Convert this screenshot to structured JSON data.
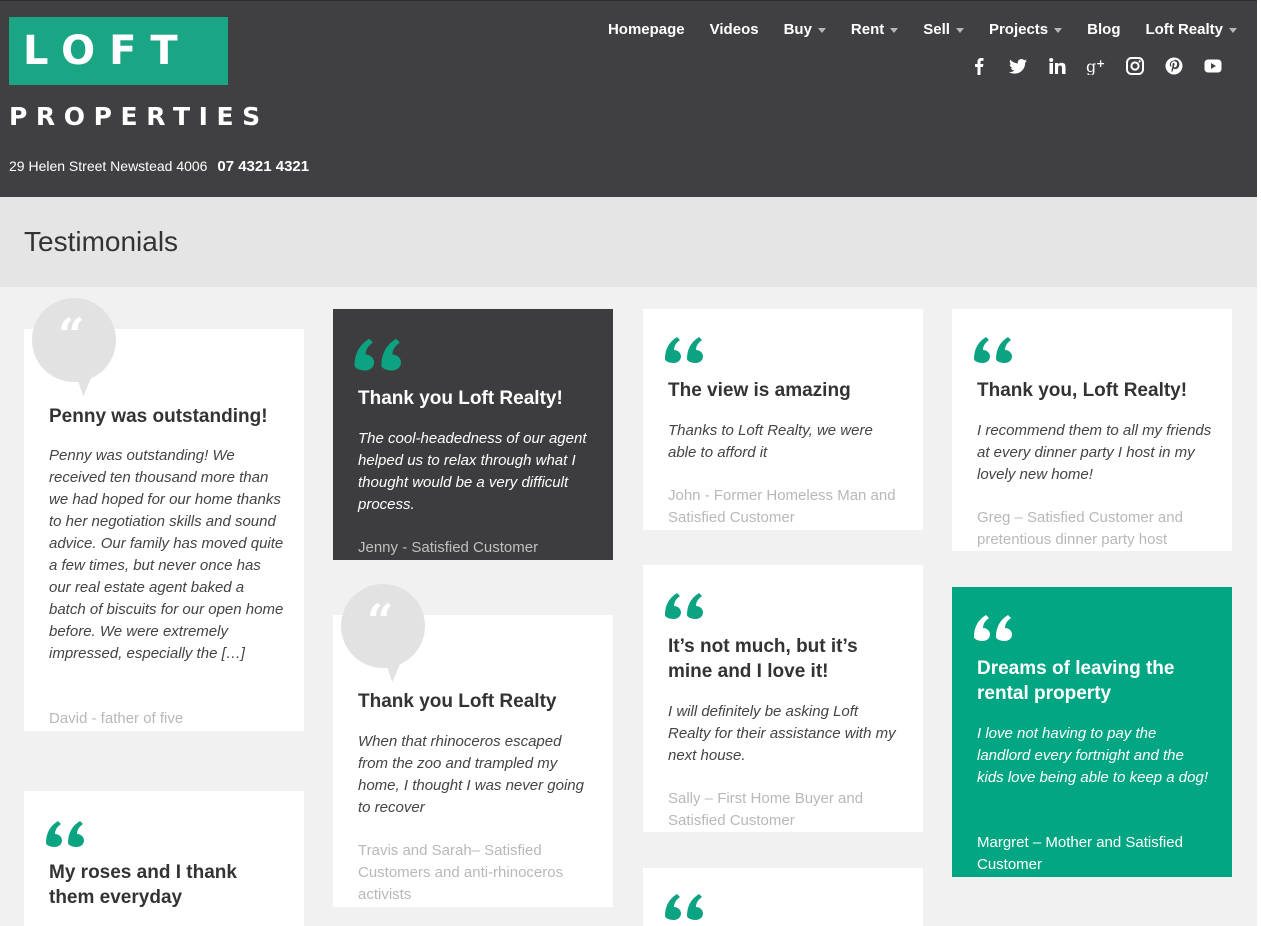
{
  "header": {
    "logo_top": "LOFT",
    "logo_bottom": "PROPERTIES",
    "address": "29 Helen Street Newstead 4006",
    "phone": "07 4321 4321",
    "nav": [
      {
        "label": "Homepage",
        "dropdown": false
      },
      {
        "label": "Videos",
        "dropdown": false
      },
      {
        "label": "Buy",
        "dropdown": true
      },
      {
        "label": "Rent",
        "dropdown": true
      },
      {
        "label": "Sell",
        "dropdown": true
      },
      {
        "label": "Projects",
        "dropdown": true
      },
      {
        "label": "Blog",
        "dropdown": false
      },
      {
        "label": "Loft Realty",
        "dropdown": true
      }
    ],
    "social": [
      "facebook-icon",
      "twitter-icon",
      "linkedin-icon",
      "google-plus-icon",
      "instagram-icon",
      "pinterest-icon",
      "youtube-icon"
    ]
  },
  "page": {
    "title": "Testimonials"
  },
  "colors": {
    "header_bg": "#404042",
    "brand_green": "#1aa684",
    "card_green": "#02a683",
    "card_dark": "#3d3d3f",
    "quote_green": "#0ba381"
  },
  "testimonials": [
    {
      "title": "Penny was outstanding!",
      "body": "Penny was outstanding! We received ten thousand more than we had hoped for our home thanks to her negotiation skills and sound advice. Our family has moved quite a few times, but never once has our real estate agent baked a batch of biscuits for our open home before. We were extremely impressed, especially the […]",
      "author": "David - father of five"
    },
    {
      "title": "My roses and I thank them everyday",
      "body": "",
      "author": ""
    },
    {
      "title": "Thank you Loft Realty!",
      "body": "The cool-headedness of our agent helped us to relax through what I thought would be a very difficult process.",
      "author": "Jenny - Satisfied Customer"
    },
    {
      "title": "Thank you Loft Realty",
      "body": "When that rhinoceros escaped from the zoo and trampled my home, I thought I was never going to recover",
      "author": "Travis and Sarah– Satisfied Customers and anti-rhinoceros activists"
    },
    {
      "title": "The view is amazing",
      "body": "Thanks to Loft Realty, we were able to afford it",
      "author": "John - Former Homeless Man and Satisfied Customer"
    },
    {
      "title": "It’s not much, but it’s mine and I love it!",
      "body": "I will definitely be asking Loft Realty for their assistance with my next house.",
      "author": "Sally – First Home Buyer and Satisfied Customer"
    },
    {
      "title": "Thank you, Loft Realty!",
      "body": "I recommend them to all my friends at every dinner party I host in my lovely new home!",
      "author": "Greg – Satisfied Customer and pretentious dinner party host"
    },
    {
      "title": "Dreams of leaving the rental property",
      "body": "I love not having to pay the landlord every fortnight and the kids love being able to keep a dog!",
      "author": "Margret – Mother and Satisfied Customer"
    }
  ]
}
